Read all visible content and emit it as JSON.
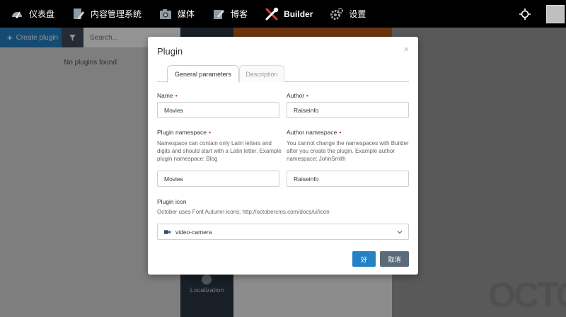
{
  "nav": {
    "items": [
      {
        "label": "仪表盘",
        "icon": "dashboard-icon"
      },
      {
        "label": "内容管理系统",
        "icon": "cms-icon"
      },
      {
        "label": "媒体",
        "icon": "media-icon"
      },
      {
        "label": "博客",
        "icon": "blog-icon"
      },
      {
        "label": "Builder",
        "icon": "builder-icon"
      },
      {
        "label": "设置",
        "icon": "settings-icon"
      }
    ]
  },
  "sidebar": {
    "create_label": "Create plugin",
    "search_placeholder": "Search...",
    "empty_text": "No plugins found"
  },
  "midnav": {
    "localization_label": "Localization"
  },
  "watermark": "OCTO",
  "modal": {
    "title": "Plugin",
    "close": "×",
    "tabs": [
      "General parameters",
      "Description"
    ],
    "name_label": "Name",
    "name_value": "Movies",
    "author_label": "Author",
    "author_value": "Raiseinfo",
    "namespace_label": "Plugin namespace",
    "namespace_help": "Namespace can contain only Latin letters and digits and should start with a Latin letter. Example plugin namespace: Blog",
    "namespace_value": "Movies",
    "author_namespace_label": "Author namespace",
    "author_namespace_help": "You cannot change the namespaces with Builder after you create the plugin. Example author namespace: JohnSmith",
    "author_namespace_value": "Raiseinfo",
    "icon_label": "Plugin icon",
    "icon_help": "October uses Font Autumn icons: http://octobercms.com/docs/ui/icon",
    "icon_value": "video-camera",
    "ok_label": "好",
    "cancel_label": "取消"
  },
  "colors": {
    "primary": "#2581c4",
    "nav_bg": "#000000",
    "required": "#c9302c",
    "cancel_bg": "#5c6b7a",
    "accent_orange": "#b85a18"
  }
}
